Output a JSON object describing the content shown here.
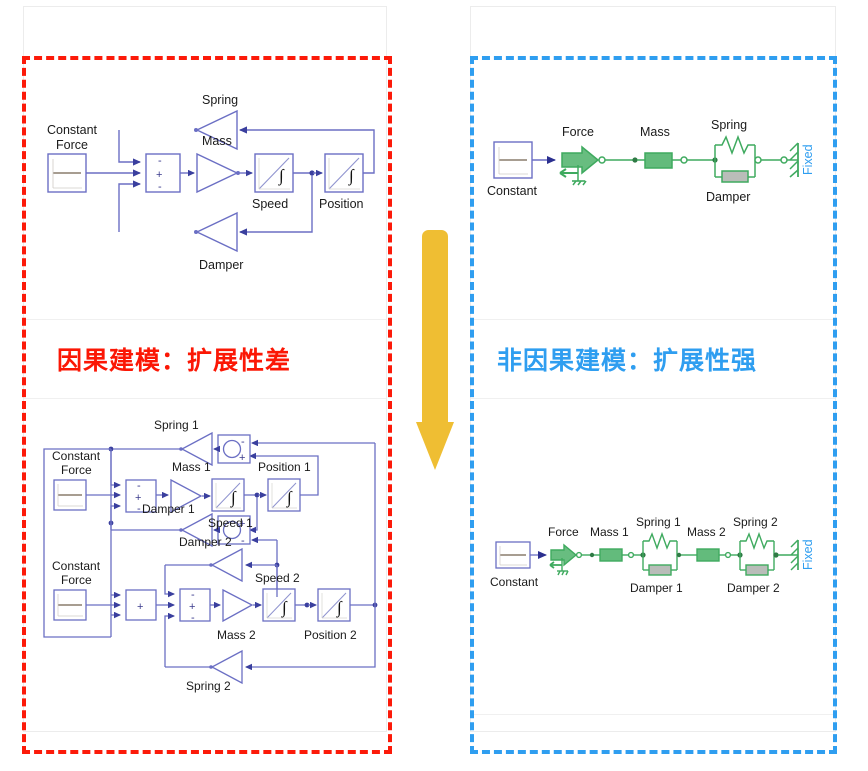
{
  "meta": {
    "slide_kind": "comparison",
    "background": "#ffffff"
  },
  "colors": {
    "causal_accent": "#fb1705",
    "acausal_accent": "#2f9ef0",
    "arrow": "#efbe33",
    "block_outline": "#6b6fc4",
    "block_outline_dark": "#3a3f9e",
    "acausal_component": "#3faa5f",
    "panel_border": "#ececec",
    "fixed_label": "#2f9ef0"
  },
  "panels": {
    "left": {
      "name": "causal-panel"
    },
    "right": {
      "name": "acausal-panel"
    }
  },
  "captions": {
    "causal": "因果建模：扩展性差",
    "acausal": "非因果建模：扩展性强"
  },
  "center_arrow": {
    "direction": "down",
    "color": "#efbe33"
  },
  "diagrams": {
    "causal_single": {
      "title_hidden": true,
      "blocks": [
        {
          "name": "constant-force-source",
          "label": "Constant\nForce",
          "label_line1": "Constant",
          "label_line2": "Force",
          "type": "source"
        },
        {
          "name": "sum-junction",
          "label": "",
          "type": "sum",
          "signs": [
            "-",
            "+",
            "-"
          ]
        },
        {
          "name": "mass-gain",
          "label": "Mass",
          "type": "gain"
        },
        {
          "name": "speed-integrator",
          "label": "Speed",
          "type": "integrator"
        },
        {
          "name": "position-integrator",
          "label": "Position",
          "type": "integrator"
        },
        {
          "name": "spring-gain",
          "label": "Spring",
          "type": "gain-feedback"
        },
        {
          "name": "damper-gain",
          "label": "Damper",
          "type": "gain-feedback"
        }
      ]
    },
    "causal_double": {
      "blocks": [
        {
          "name": "constant-force-source-1",
          "label_line1": "Constant",
          "label_line2": "Force",
          "type": "source"
        },
        {
          "name": "constant-force-source-2",
          "label_line1": "Constant",
          "label_line2": "Force",
          "type": "source"
        },
        {
          "name": "sum-junction-1",
          "type": "sum",
          "signs": [
            "-",
            "+",
            "-"
          ]
        },
        {
          "name": "sum-junction-2a",
          "type": "sum",
          "signs": [
            "+"
          ]
        },
        {
          "name": "sum-junction-2b",
          "type": "sum",
          "signs": [
            "-",
            "+",
            "-"
          ]
        },
        {
          "name": "mass-gain-1",
          "label": "Mass 1",
          "type": "gain"
        },
        {
          "name": "mass-gain-2",
          "label": "Mass 2",
          "type": "gain"
        },
        {
          "name": "speed-integrator-1",
          "label": "Speed 1",
          "type": "integrator"
        },
        {
          "name": "speed-integrator-2",
          "label": "Speed 2",
          "type": "integrator"
        },
        {
          "name": "position-integrator-1",
          "label": "Position 1",
          "type": "integrator"
        },
        {
          "name": "position-integrator-2",
          "label": "Position 2",
          "type": "integrator"
        },
        {
          "name": "spring-gain-1",
          "label": "Spring 1",
          "type": "gain-feedback"
        },
        {
          "name": "spring-gain-2",
          "label": "Spring 2",
          "type": "gain-feedback"
        },
        {
          "name": "damper-gain-1",
          "label": "Damper 1",
          "type": "gain-feedback"
        },
        {
          "name": "damper-gain-2",
          "label": "Damper 2",
          "type": "gain-feedback"
        },
        {
          "name": "relative-sum-circle-spring-1",
          "type": "sum-circle",
          "signs": [
            "-",
            "+"
          ]
        },
        {
          "name": "relative-sum-circle-damper-1",
          "type": "sum-circle",
          "signs": [
            "+",
            "-"
          ]
        }
      ]
    },
    "acausal_single": {
      "components": [
        {
          "name": "constant-source",
          "label": "Constant",
          "label_pos": "below"
        },
        {
          "name": "force-actuator",
          "label": "Force",
          "label_pos": "above"
        },
        {
          "name": "mass-component",
          "label": "Mass",
          "label_pos": "above"
        },
        {
          "name": "spring-component",
          "label": "Spring",
          "label_pos": "above"
        },
        {
          "name": "damper-component",
          "label": "Damper",
          "label_pos": "below"
        },
        {
          "name": "fixed-ground",
          "label": "Fixed",
          "label_pos": "rotated-right"
        }
      ]
    },
    "acausal_double": {
      "components": [
        {
          "name": "constant-source",
          "label": "Constant",
          "label_pos": "below"
        },
        {
          "name": "force-actuator",
          "label": "Force",
          "label_pos": "above"
        },
        {
          "name": "mass-component-1",
          "label": "Mass 1",
          "label_pos": "above"
        },
        {
          "name": "spring-component-1",
          "label": "Spring 1",
          "label_pos": "above"
        },
        {
          "name": "damper-component-1",
          "label": "Damper 1",
          "label_pos": "below"
        },
        {
          "name": "mass-component-2",
          "label": "Mass 2",
          "label_pos": "above"
        },
        {
          "name": "spring-component-2",
          "label": "Spring 2",
          "label_pos": "above"
        },
        {
          "name": "damper-component-2",
          "label": "Damper 2",
          "label_pos": "below"
        },
        {
          "name": "fixed-ground",
          "label": "Fixed",
          "label_pos": "rotated-right"
        }
      ]
    }
  },
  "labels": {
    "constant": "Constant",
    "constant_force_l1": "Constant",
    "constant_force_l2": "Force",
    "force": "Force",
    "mass": "Mass",
    "mass1": "Mass 1",
    "mass2": "Mass 2",
    "speed": "Speed",
    "speed1": "Speed 1",
    "speed2": "Speed 2",
    "position": "Position",
    "position1": "Position 1",
    "position2": "Position 2",
    "spring": "Spring",
    "spring1": "Spring 1",
    "spring2": "Spring 2",
    "damper": "Damper",
    "damper1": "Damper 1",
    "damper2": "Damper 2",
    "fixed": "Fixed",
    "plus": "+",
    "minus": "-"
  }
}
